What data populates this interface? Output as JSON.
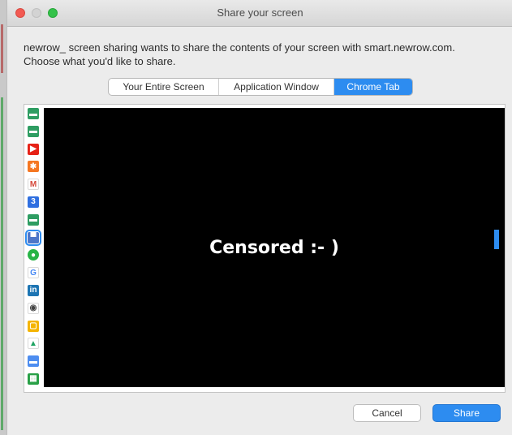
{
  "window": {
    "title": "Share your screen"
  },
  "prompt": {
    "line1": "newrow_ screen sharing wants to share the contents of your screen with smart.newrow.com.",
    "line2": "Choose what you'd like to share."
  },
  "tabs": [
    {
      "label": "Your Entire Screen",
      "selected": false
    },
    {
      "label": "Application Window",
      "selected": false
    },
    {
      "label": "Chrome Tab",
      "selected": true
    }
  ],
  "preview": {
    "text": "Censored :- )"
  },
  "tab_icons": [
    {
      "name": "green-doc-icon",
      "color": "#2e9d62",
      "glyph": "▬"
    },
    {
      "name": "green-doc-icon",
      "color": "#2e9d62",
      "glyph": "▬"
    },
    {
      "name": "youtube-icon",
      "color": "#e62117",
      "glyph": "▶"
    },
    {
      "name": "hubspot-icon",
      "color": "#f57722",
      "glyph": "✱"
    },
    {
      "name": "gmail-icon",
      "color": "#ffffff",
      "glyph": "M"
    },
    {
      "name": "calendar-icon",
      "color": "#2f6fe0",
      "glyph": "3"
    },
    {
      "name": "green-doc-icon",
      "color": "#2e9d62",
      "glyph": "▬"
    },
    {
      "name": "browser-tab-icon",
      "color": "#4d76c8",
      "glyph": "▀"
    },
    {
      "name": "whatsapp-icon",
      "color": "#28b446",
      "glyph": "●"
    },
    {
      "name": "google-icon",
      "color": "#ffffff",
      "glyph": "G"
    },
    {
      "name": "linkedin-icon",
      "color": "#1d75b3",
      "glyph": "in"
    },
    {
      "name": "incognito-icon",
      "color": "#ffffff",
      "glyph": "◉"
    },
    {
      "name": "slides-icon",
      "color": "#f4b400",
      "glyph": "▢"
    },
    {
      "name": "drive-icon",
      "color": "#ffffff",
      "glyph": "▲"
    },
    {
      "name": "chat-icon",
      "color": "#4d8df0",
      "glyph": "▬"
    },
    {
      "name": "sheets-icon",
      "color": "#28a046",
      "glyph": "▦"
    }
  ],
  "buttons": {
    "cancel": "Cancel",
    "share": "Share"
  }
}
